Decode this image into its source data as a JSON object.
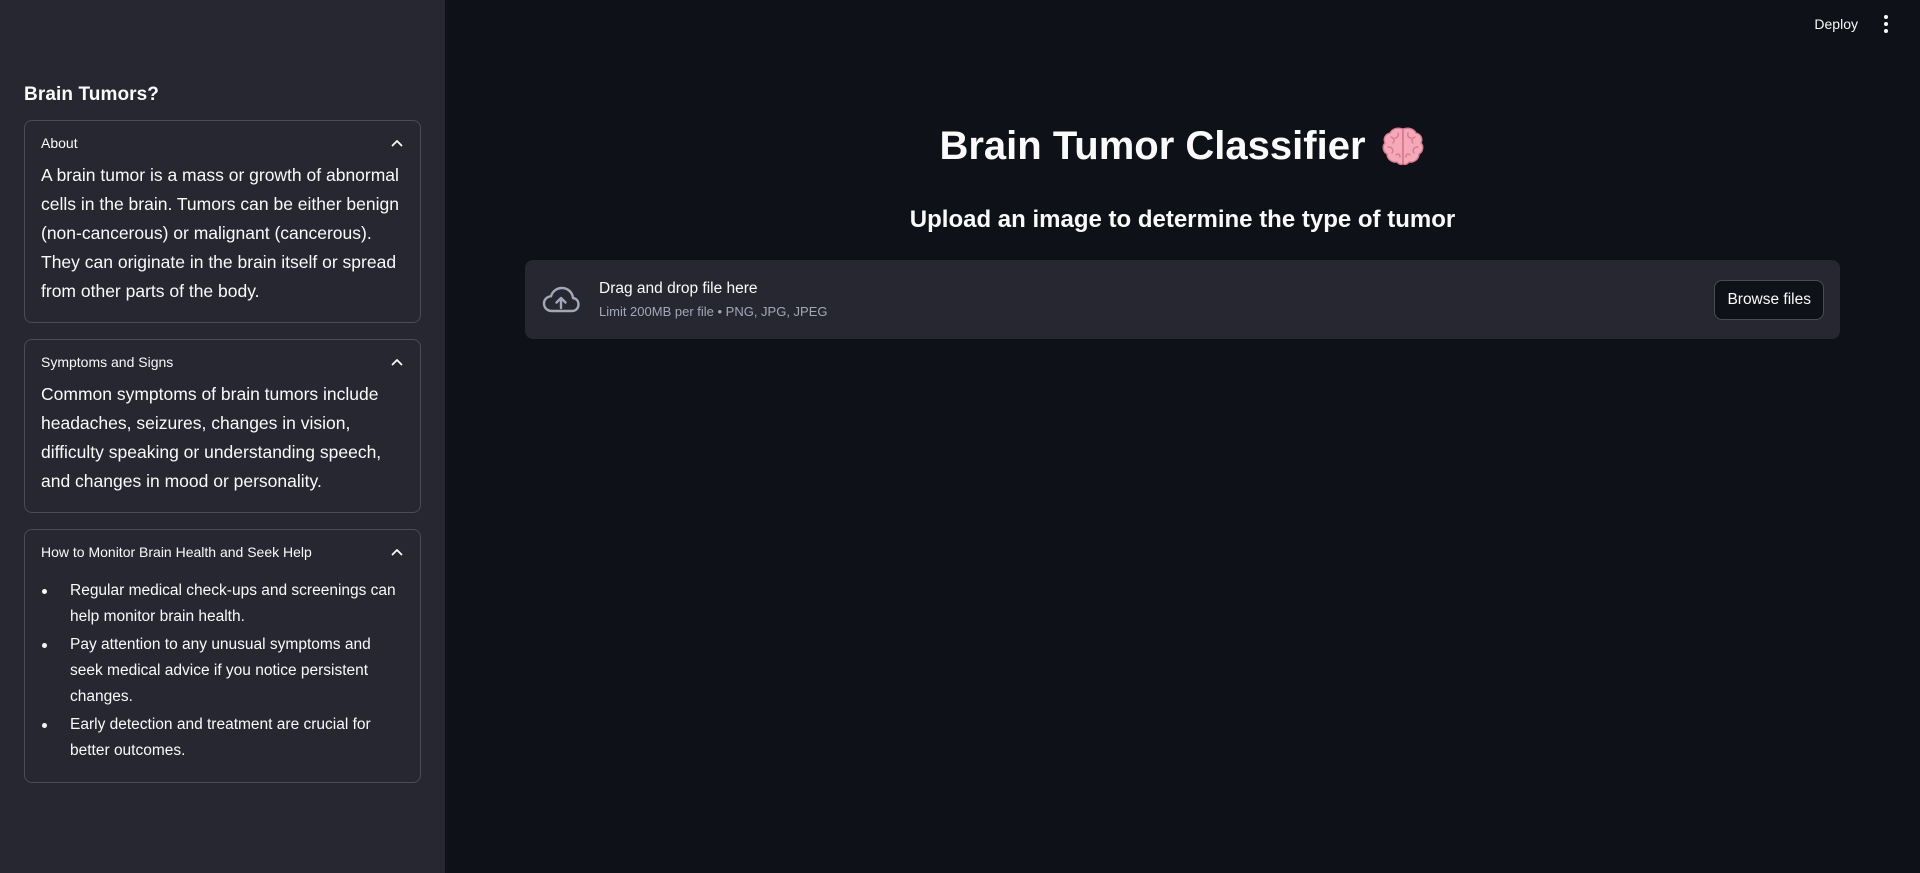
{
  "sidebar": {
    "title": "Brain Tumors?",
    "expanders": [
      {
        "title": "About",
        "body": "A brain tumor is a mass or growth of abnormal cells in the brain. Tumors can be either benign (non-cancerous) or malignant (cancerous). They can originate in the brain itself or spread from other parts of the body."
      },
      {
        "title": "Symptoms and Signs",
        "body": "Common symptoms of brain tumors include headaches, seizures, changes in vision, difficulty speaking or understanding speech, and changes in mood or personality."
      },
      {
        "title": "How to Monitor Brain Health and Seek Help",
        "items": [
          "Regular medical check-ups and screenings can help monitor brain health.",
          "Pay attention to any unusual symptoms and seek medical advice if you notice persistent changes.",
          "Early detection and treatment are crucial for better outcomes."
        ]
      }
    ]
  },
  "header": {
    "deploy_label": "Deploy",
    "menu_icon": "kebab-vertical-icon"
  },
  "main": {
    "title": "Brain Tumor Classifier",
    "title_icon": "brain-emoji",
    "subtitle": "Upload an image to determine the type of tumor",
    "uploader": {
      "icon": "cloud-upload-icon",
      "label": "Drag and drop file here",
      "limit": "Limit 200MB per file • PNG, JPG, JPEG",
      "browse_label": "Browse files"
    }
  },
  "colors": {
    "background": "#0e1117",
    "sidebar": "#262730",
    "text": "#fafafa",
    "muted": "#a3a8b8",
    "border": "#4a4c55"
  }
}
